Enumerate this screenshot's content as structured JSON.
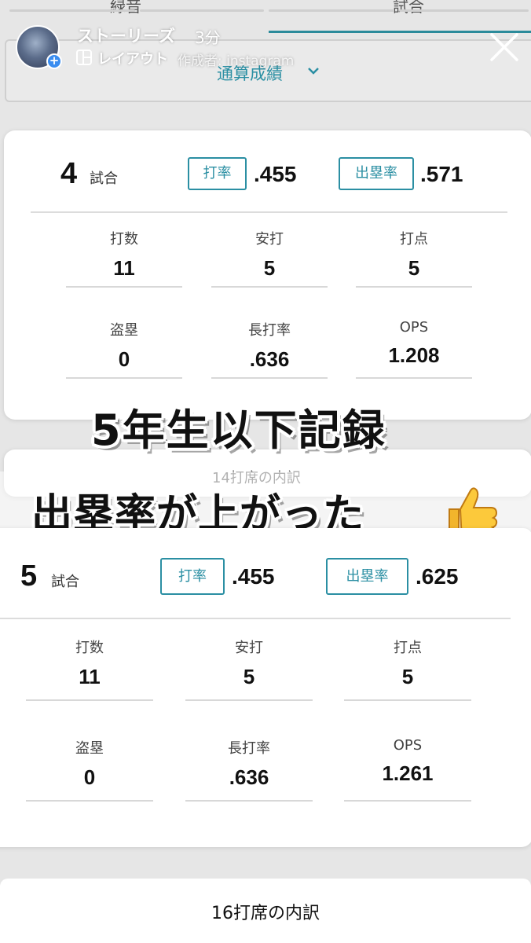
{
  "background_tabs": {
    "left": "緑音",
    "right": "試合"
  },
  "story": {
    "username": "ストーリーズ",
    "time": "3分",
    "layout_label": "レイアウト",
    "author": "作成者: instagram"
  },
  "season_select": {
    "label": "通算成績"
  },
  "card1": {
    "games": "4",
    "games_unit": "試合",
    "avg_label": "打率",
    "avg_value": ".455",
    "obp_label": "出塁率",
    "obp_value": ".571",
    "stats": [
      {
        "label": "打数",
        "value": "11"
      },
      {
        "label": "安打",
        "value": "5"
      },
      {
        "label": "打点",
        "value": "5"
      },
      {
        "label": "盗塁",
        "value": "0"
      },
      {
        "label": "長打率",
        "value": ".636"
      },
      {
        "label": "OPS",
        "value": "1.208"
      }
    ]
  },
  "card2_peek": {
    "text": "14打席の内訳"
  },
  "overlay": {
    "line1": "5年生以下記録",
    "line2": "出塁率が上がった"
  },
  "card3": {
    "games": "5",
    "games_unit": "試合",
    "avg_label": "打率",
    "avg_value": ".455",
    "obp_label": "出塁率",
    "obp_value": ".625",
    "stats": [
      {
        "label": "打数",
        "value": "11"
      },
      {
        "label": "安打",
        "value": "5"
      },
      {
        "label": "打点",
        "value": "5"
      },
      {
        "label": "盗塁",
        "value": "0"
      },
      {
        "label": "長打率",
        "value": ".636"
      },
      {
        "label": "OPS",
        "value": "1.261"
      }
    ]
  },
  "bottom": {
    "breakdown": "16打席の内訳"
  },
  "colors": {
    "accent": "#2b8fa3",
    "progress": "#2c8b9b"
  },
  "icons": [
    "layout-icon",
    "close-icon",
    "chevron-down-icon",
    "thumbs-up-icon",
    "add-icon"
  ]
}
